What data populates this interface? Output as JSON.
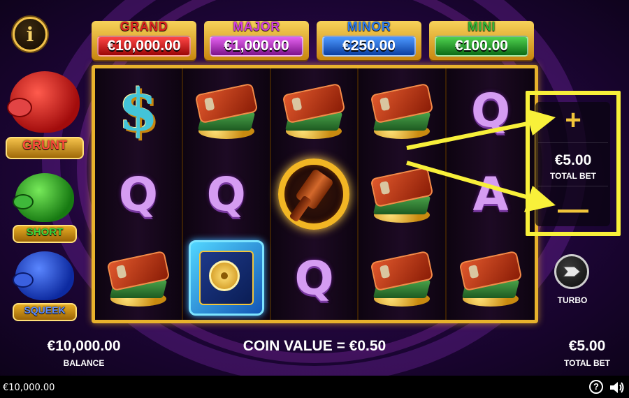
{
  "info_button": {
    "label": "i"
  },
  "jackpots": [
    {
      "title": "GRAND",
      "value": "€10,000.00"
    },
    {
      "title": "MAJOR",
      "value": "€1,000.00"
    },
    {
      "title": "MINOR",
      "value": "€250.00"
    },
    {
      "title": "MINI",
      "value": "€100.00"
    }
  ],
  "pigs": [
    {
      "label": "GRUNT",
      "color": "#d01b1b"
    },
    {
      "label": "SHORT",
      "color": "#2aa82a"
    },
    {
      "label": "SQUEEK",
      "color": "#1b3fd0"
    }
  ],
  "reels": [
    [
      "dollar",
      "Q",
      "wallet"
    ],
    [
      "wallet",
      "Q",
      "safe"
    ],
    [
      "wallet",
      "hammer",
      "Q"
    ],
    [
      "wallet",
      "wallet",
      "wallet"
    ],
    [
      "Q",
      "A",
      "wallet"
    ]
  ],
  "bet_panel": {
    "plus": "+",
    "value": "€5.00",
    "label": "TOTAL BET",
    "minus": "—"
  },
  "turbo": {
    "label": "TURBO"
  },
  "footer": {
    "balance_value": "€10,000.00",
    "balance_label": "BALANCE",
    "coin_value": "COIN VALUE = €0.50",
    "total_bet_value": "€5.00",
    "total_bet_label": "TOTAL BET"
  },
  "status_bar": {
    "balance": "€10,000.00",
    "help_label": "?"
  },
  "colors": {
    "highlight": "#f8f03a",
    "gold": "#e8b22c",
    "background": "#2a0845"
  }
}
